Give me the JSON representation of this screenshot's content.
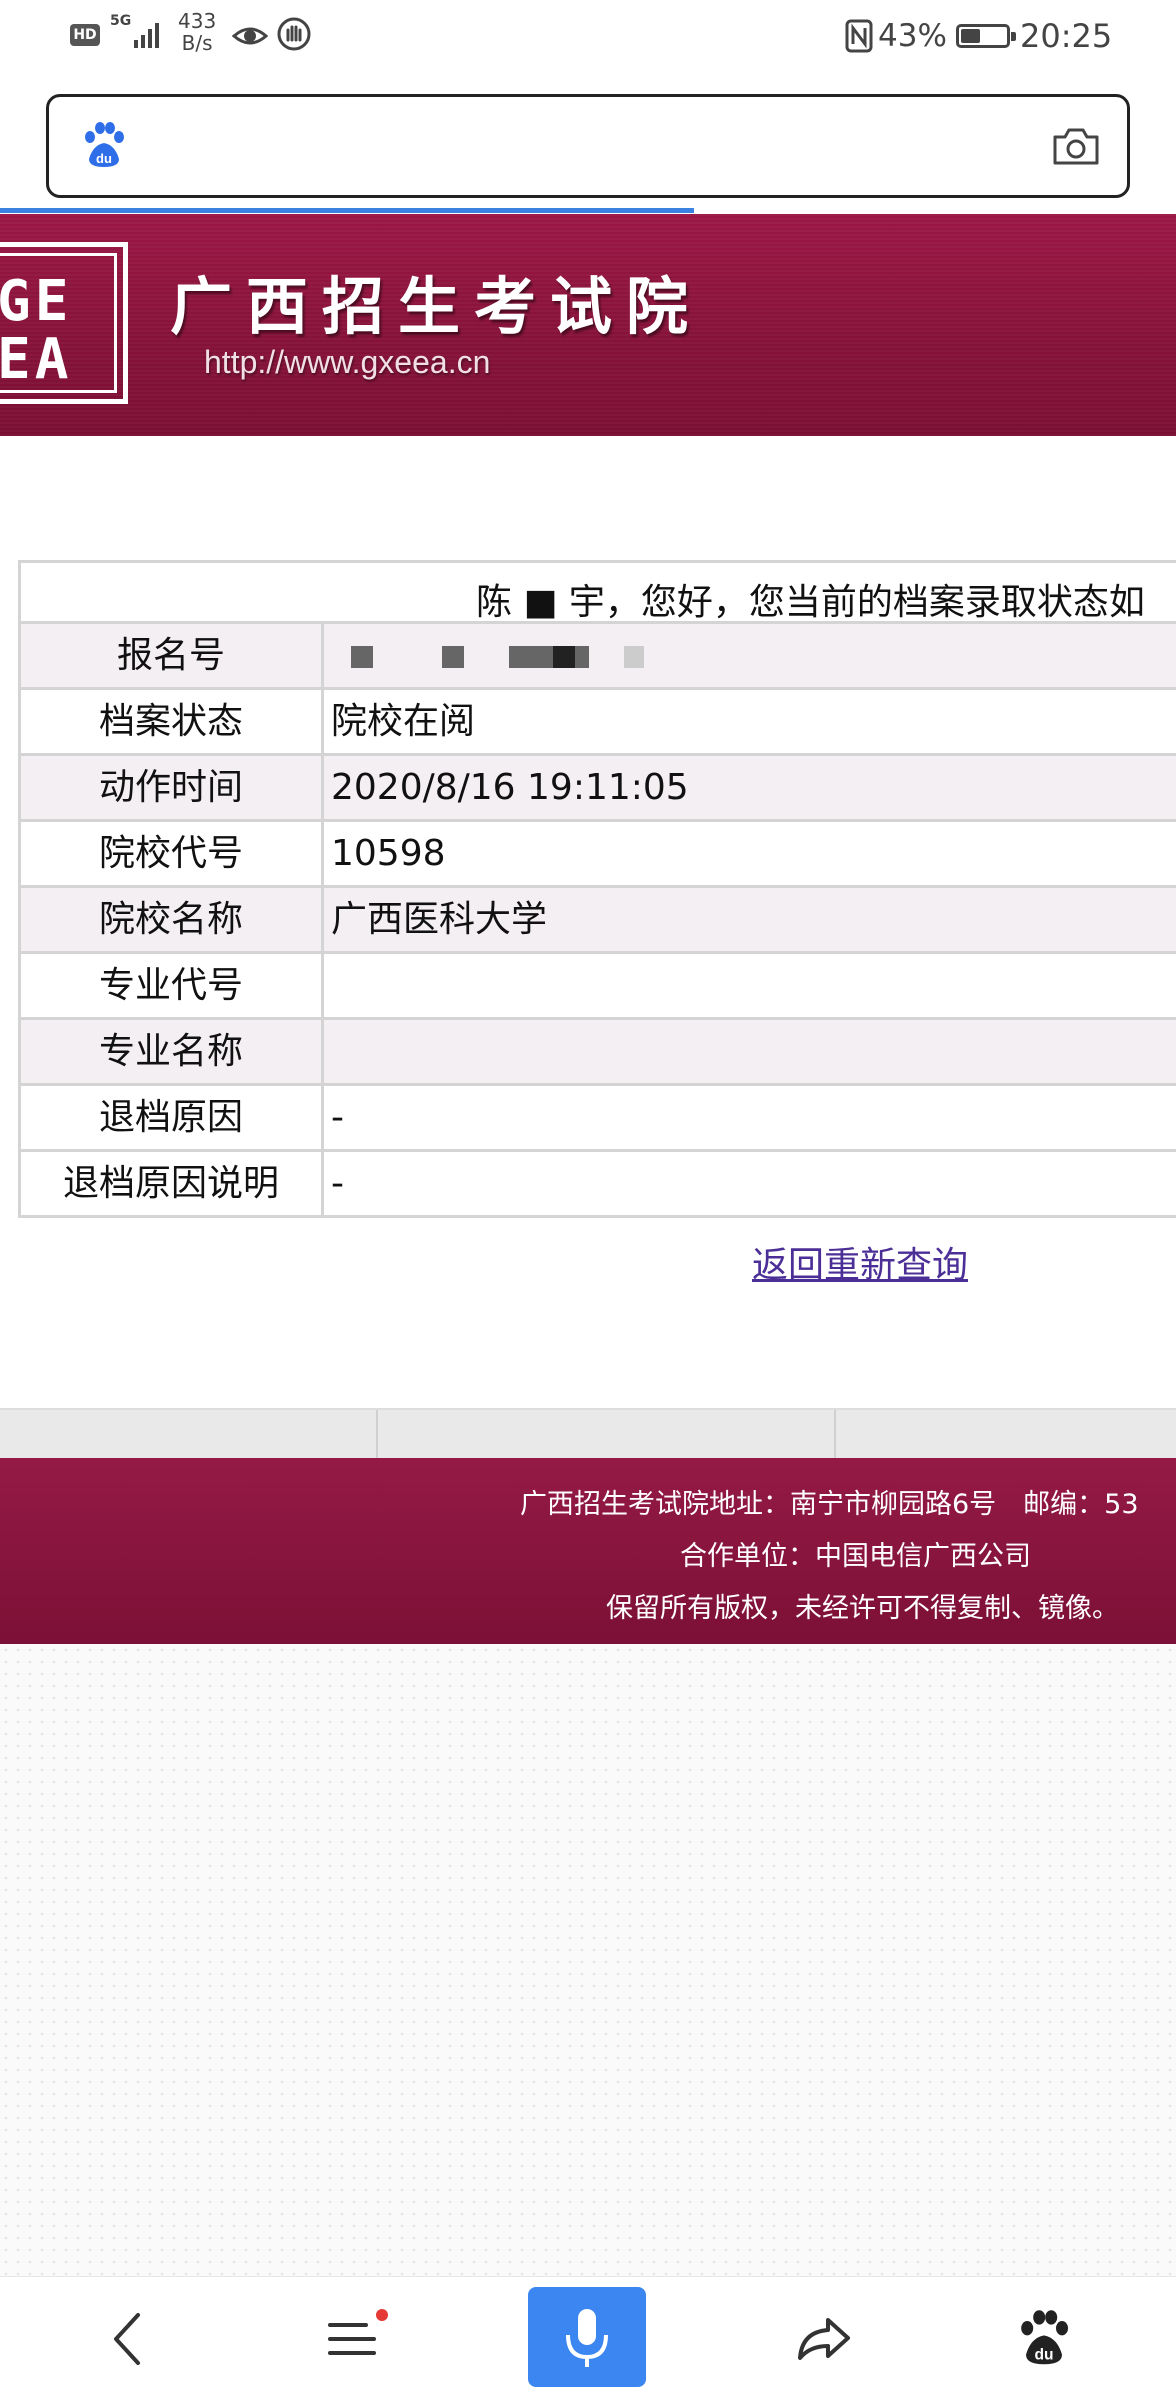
{
  "status_bar": {
    "hd": "HD",
    "network": "5G",
    "speed_value": "433",
    "speed_unit": "B/s",
    "battery": "43%",
    "battery_level": 0.43,
    "time": "20:25",
    "icons": [
      "hd-icon",
      "signal-icon",
      "eye-icon",
      "hand-icon",
      "nfc-icon",
      "battery-icon"
    ]
  },
  "browser": {
    "search_placeholder": "",
    "logo_icon": "baidu-paw-icon",
    "camera_icon": "camera-icon",
    "load_progress": 0.59,
    "progress_color": "#3a83e3"
  },
  "site_header": {
    "logo_text_top": "GE",
    "logo_text_bottom": "EA",
    "title": "广西招生考试院",
    "url": "http://www.gxeea.cn",
    "brand_color": "#861239"
  },
  "result": {
    "greeting": "陈 ■ 宇，您好，您当前的档案录取状态如",
    "rows": [
      {
        "label": "报名号",
        "value": ""
      },
      {
        "label": "档案状态",
        "value": "院校在阅"
      },
      {
        "label": "动作时间",
        "value": "2020/8/16 19:11:05"
      },
      {
        "label": "院校代号",
        "value": "10598"
      },
      {
        "label": "院校名称",
        "value": "广西医科大学"
      },
      {
        "label": "专业代号",
        "value": ""
      },
      {
        "label": "专业名称",
        "value": ""
      },
      {
        "label": "退档原因",
        "value": "-"
      },
      {
        "label": "退档原因说明",
        "value": "-"
      }
    ],
    "back_link": "返回重新查询"
  },
  "footer": {
    "address": "广西招生考试院地址：南宁市柳园路6号　邮编：53",
    "partner": "合作单位：中国电信广西公司",
    "copyright": "保留所有版权，未经许可不得复制、镜像。"
  },
  "bottom_nav": {
    "items": [
      "back-arrow-icon",
      "menu-icon",
      "mic-icon",
      "share-icon",
      "baidu-paw-icon"
    ],
    "accent": "#3b86f0"
  }
}
